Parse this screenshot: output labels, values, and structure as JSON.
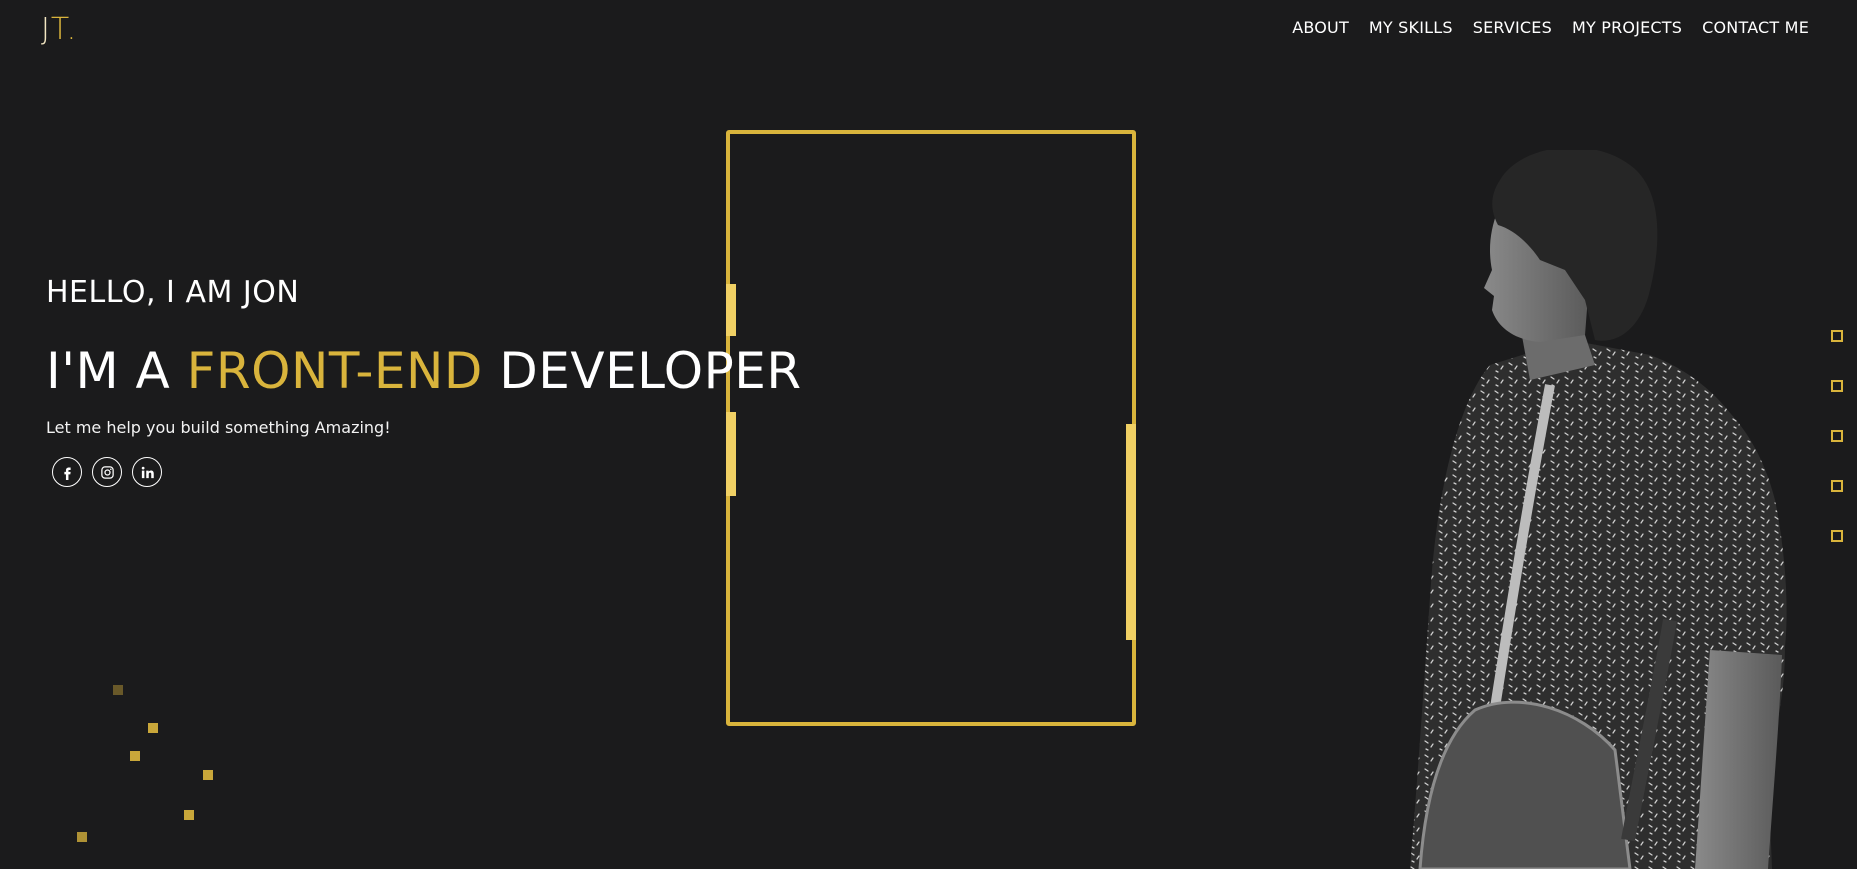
{
  "logo": {
    "part1": "J",
    "part2": "T."
  },
  "nav": {
    "items": [
      {
        "label": "ABOUT"
      },
      {
        "label": "MY SKILLS"
      },
      {
        "label": "SERVICES"
      },
      {
        "label": "MY PROJECTS"
      },
      {
        "label": "CONTACT ME"
      }
    ]
  },
  "hero": {
    "greeting": "HELLO, I AM JON",
    "headline_prefix": "I'M A ",
    "headline_accent": "FRONT-END",
    "headline_suffix": " DEVELOPER",
    "tagline": "Let me help you build something Amazing!"
  },
  "socials": [
    {
      "icon": "facebook-icon"
    },
    {
      "icon": "instagram-icon"
    },
    {
      "icon": "linkedin-icon"
    }
  ],
  "colors": {
    "background": "#1b1b1c",
    "accent": "#d9b43c",
    "text": "#ffffff"
  }
}
